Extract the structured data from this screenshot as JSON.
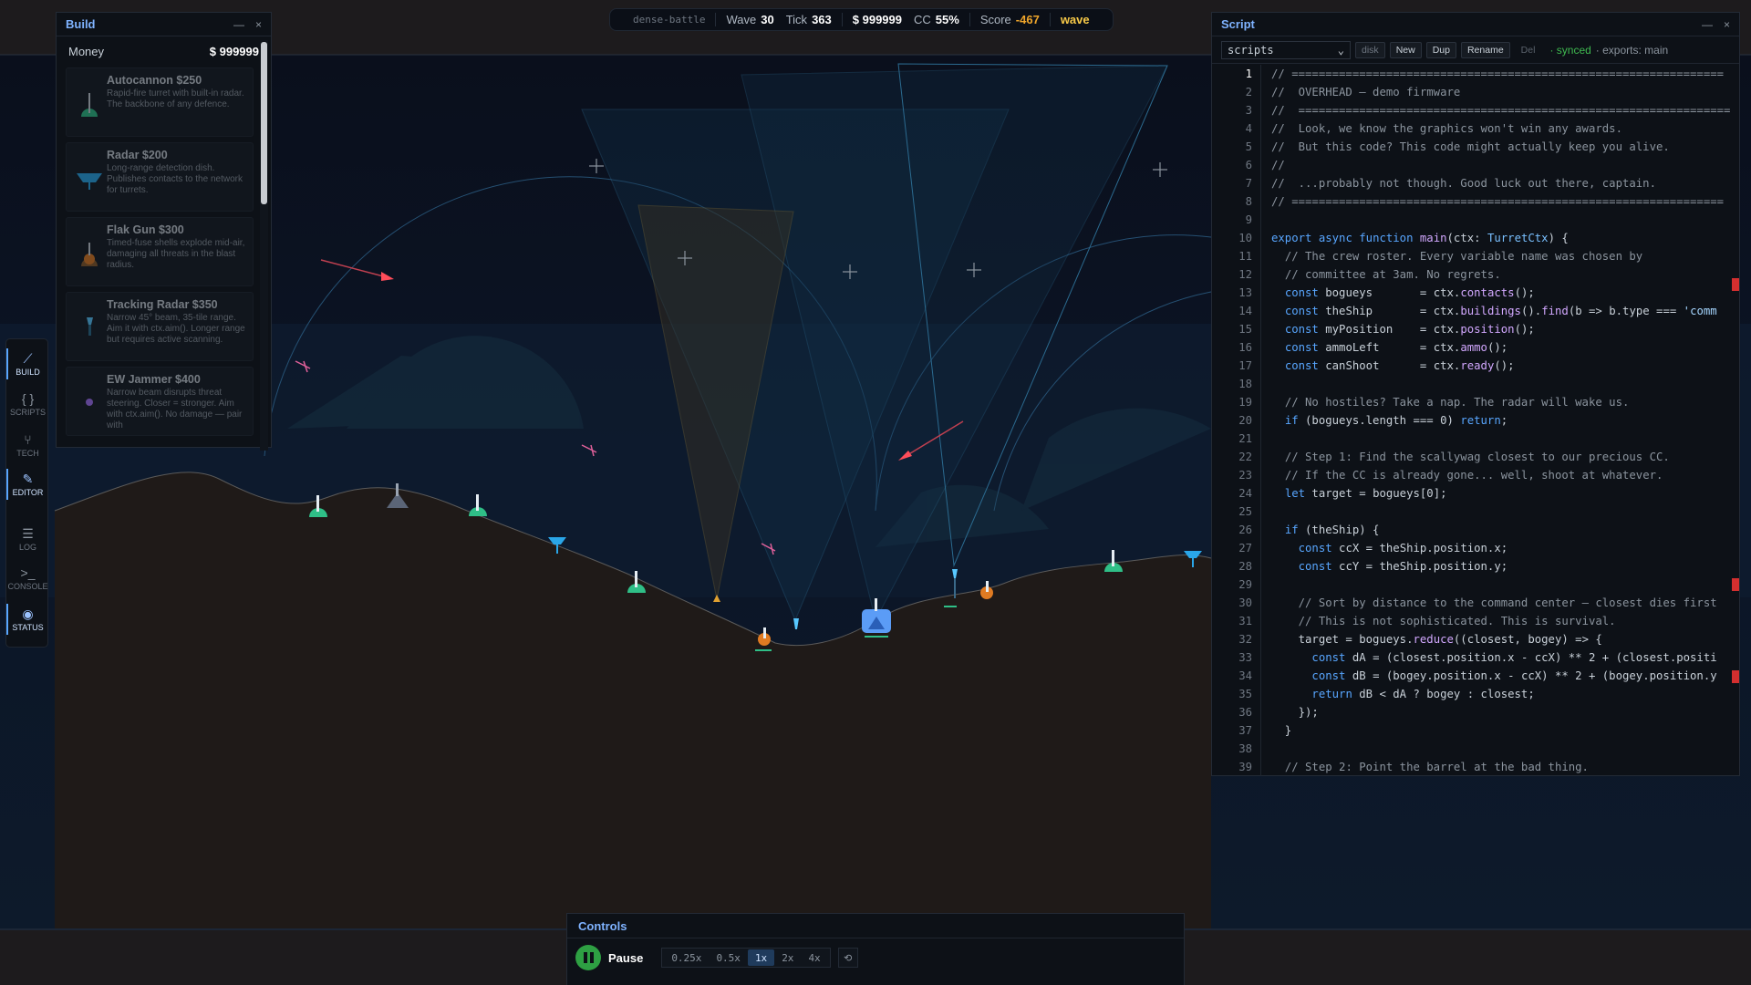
{
  "hud": {
    "scenario": "dense-battle",
    "wave_label": "Wave",
    "wave": "30",
    "tick_label": "Tick",
    "tick": "363",
    "money": "$ 999999",
    "cc_label": "CC",
    "cc": "55%",
    "score_label": "Score",
    "score": "-467",
    "phase": "wave"
  },
  "build": {
    "title": "Build",
    "money_label": "Money",
    "money_value": "$ 999999",
    "items": [
      {
        "name": "Autocannon $250",
        "desc": "Rapid-fire turret with built-in radar. The backbone of any defence.",
        "icon": "autocannon-icon"
      },
      {
        "name": "Radar $200",
        "desc": "Long-range detection dish. Publishes contacts to the network for turrets.",
        "icon": "radar-icon"
      },
      {
        "name": "Flak Gun $300",
        "desc": "Timed-fuse shells explode mid-air, damaging all threats in the blast radius.",
        "icon": "flak-gun-icon"
      },
      {
        "name": "Tracking Radar $350",
        "desc": "Narrow 45° beam, 35-tile range. Aim it with ctx.aim(). Longer range but requires active scanning.",
        "icon": "tracking-radar-icon"
      },
      {
        "name": "EW Jammer $400",
        "desc": "Narrow beam disrupts threat steering. Closer = stronger. Aim with ctx.aim(). No damage — pair with",
        "icon": "jammer-icon"
      }
    ]
  },
  "nav": [
    {
      "label": "BUILD",
      "glyph": "⟋",
      "icon": "hammer-icon",
      "active": true
    },
    {
      "label": "SCRIPTS",
      "glyph": "{ }",
      "icon": "braces-icon",
      "active": false
    },
    {
      "label": "TECH",
      "glyph": "⑂",
      "icon": "tech-tree-icon",
      "active": false
    },
    {
      "label": "EDITOR",
      "glyph": "✎",
      "icon": "pencil-icon",
      "active": true
    },
    {
      "label": "LOG",
      "glyph": "☰",
      "icon": "list-icon",
      "active": false
    },
    {
      "label": "CONSOLE",
      "glyph": ">_",
      "icon": "terminal-icon",
      "active": false
    },
    {
      "label": "STATUS",
      "glyph": "◉",
      "icon": "eye-icon",
      "active": true
    }
  ],
  "script": {
    "title": "Script",
    "selected": "scripts",
    "buttons": {
      "disk": "disk",
      "new": "New",
      "dup": "Dup",
      "rename": "Rename",
      "del": "Del"
    },
    "status": "· synced",
    "exports": "· exports: main",
    "current_line": 1,
    "lines": [
      "// ================================================================",
      "//  OVERHEAD — demo firmware",
      "//  ================================================================",
      "//  Look, we know the graphics won't win any awards.",
      "//  But this code? This code might actually keep you alive.",
      "//",
      "//  ...probably not though. Good luck out there, captain.",
      "// ================================================================",
      "",
      "export async function main(ctx: TurretCtx) {",
      "  // The crew roster. Every variable name was chosen by",
      "  // committee at 3am. No regrets.",
      "  const bogueys       = ctx.contacts();",
      "  const theShip       = ctx.buildings().find(b => b.type === 'comm",
      "  const myPosition    = ctx.position();",
      "  const ammoLeft      = ctx.ammo();",
      "  const canShoot      = ctx.ready();",
      "",
      "  // No hostiles? Take a nap. The radar will wake us.",
      "  if (bogueys.length === 0) return;",
      "",
      "  // Step 1: Find the scallywag closest to our precious CC.",
      "  // If the CC is already gone... well, shoot at whatever.",
      "  let target = bogueys[0];",
      "",
      "  if (theShip) {",
      "    const ccX = theShip.position.x;",
      "    const ccY = theShip.position.y;",
      "",
      "    // Sort by distance to the command center — closest dies first",
      "    // This is not sophisticated. This is survival.",
      "    target = bogueys.reduce((closest, bogey) => {",
      "      const dA = (closest.position.x - ccX) ** 2 + (closest.positi",
      "      const dB = (bogey.position.x - ccX) ** 2 + (bogey.position.y",
      "      return dB < dA ? bogey : closest;",
      "    });",
      "  }",
      "",
      "  // Step 2: Point the barrel at the bad thing."
    ]
  },
  "controls": {
    "title": "Controls",
    "pause_label": "Pause",
    "speeds": [
      "0.25x",
      "0.5x",
      "1x",
      "2x",
      "4x"
    ],
    "active_speed": "1x",
    "reset_glyph": "⟲"
  },
  "colors": {
    "sky": "#0b1120",
    "ground": "#1f1a18",
    "accent": "#7fb3ff",
    "synced": "#3fb950",
    "turret": "#2fbf87",
    "flak": "#e07b22",
    "radar": "#2aa6e8",
    "missile": "#ff4d5a"
  }
}
